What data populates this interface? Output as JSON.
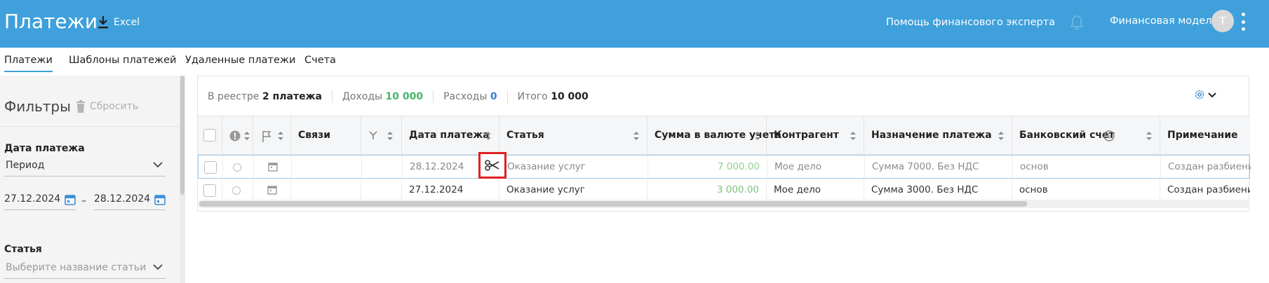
{
  "header": {
    "title": "Платежи",
    "excel_label": "Excel",
    "expert_help": "Помощь финансового эксперта",
    "finmodel": "Финансовая модель",
    "avatar_letter": "Т"
  },
  "tabs": [
    "Платежи",
    "Шаблоны платежей",
    "Удаленные платежи",
    "Счета"
  ],
  "filters": {
    "title": "Фильтры",
    "reset": "Сбросить",
    "date_label": "Дата платежа",
    "period_value": "Период",
    "date_from": "27.12.2024",
    "date_to": "28.12.2024",
    "dash": "–",
    "article_label": "Статья",
    "article_placeholder": "Выберите название статьи"
  },
  "summary": {
    "in_registry_label": "В реестре",
    "in_registry_value": "2 платежа",
    "income_label": "Доходы",
    "income_value": "10 000",
    "expense_label": "Расходы",
    "expense_value": "0",
    "total_label": "Итого",
    "total_value": "10 000"
  },
  "columns": {
    "links": "Связи",
    "date": "Дата платежа",
    "article": "Статья",
    "amount": "Сумма в валюте учета",
    "counterparty": "Контрагент",
    "purpose": "Назначение платежа",
    "bank": "Банковский счет",
    "note": "Примечание"
  },
  "rows": [
    {
      "date": "28.12.2024",
      "article": "Оказание услуг",
      "amount": "7 000.00",
      "counterparty": "Мое дело",
      "purpose": "Сумма 7000. Без НДС",
      "bank": "основ",
      "note": "Создан разбиение"
    },
    {
      "date": "27.12.2024",
      "article": "Оказание услуг",
      "amount": "3 000.00",
      "counterparty": "Мое дело",
      "purpose": "Сумма 3000. Без НДС",
      "bank": "основ",
      "note": "Создан разбиение"
    }
  ],
  "colors": {
    "header_bg": "#3fa0db",
    "income_green": "#45b56a",
    "expense_blue": "#3a7fd5",
    "highlight_red": "#e02020"
  }
}
